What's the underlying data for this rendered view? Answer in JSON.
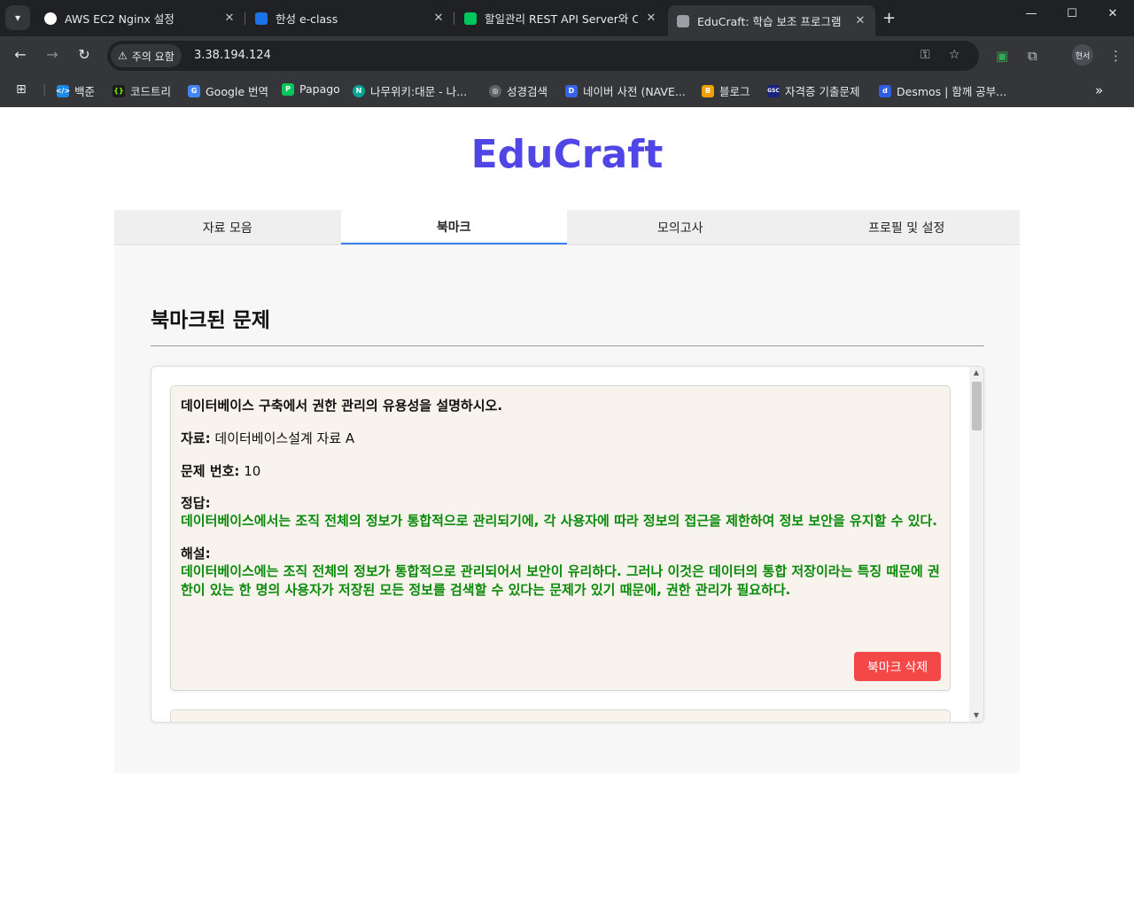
{
  "browser": {
    "tabs": [
      {
        "title": "AWS EC2 Nginx 설정",
        "active": false,
        "favicon": "openai-icon"
      },
      {
        "title": "한성 e-class",
        "active": false,
        "favicon": "eclass-icon"
      },
      {
        "title": "할일관리 REST API Server와 Cl",
        "active": false,
        "favicon": "blog-icon"
      },
      {
        "title": "EduCraft: 학습 보조 프로그램",
        "active": true,
        "favicon": "educraft-icon"
      }
    ],
    "security_chip": "주의 요함",
    "url": "3.38.194.124",
    "profile_label": "현서",
    "bookmarks": [
      {
        "label": "백준",
        "color": "#1e88e5",
        "glyph": "</>"
      },
      {
        "label": "코드트리",
        "color": "#1b1b1b",
        "glyph": "{}"
      },
      {
        "label": "Google 번역",
        "color": "#4285f4",
        "glyph": "G"
      },
      {
        "label": "Papago",
        "color": "#03c75a",
        "glyph": "P"
      },
      {
        "label": "나무위키:대문 - 나...",
        "color": "#00a495",
        "glyph": "N"
      },
      {
        "label": "성경검색",
        "color": "#5f6368",
        "glyph": "◎"
      },
      {
        "label": "네이버 사전 (NAVE...",
        "color": "#3563e9",
        "glyph": "D"
      },
      {
        "label": "블로그",
        "color": "#f6a000",
        "glyph": "B"
      },
      {
        "label": "자격증 기출문제",
        "color": "#1a237e",
        "glyph": "GSC"
      },
      {
        "label": "Desmos | 함께 공부...",
        "color": "#2f5fe0",
        "glyph": "d"
      }
    ]
  },
  "app": {
    "brand": "EduCraft",
    "brand_color": "#4f46e5",
    "nav_tabs": [
      {
        "label": "자료 모음",
        "active": false
      },
      {
        "label": "북마크",
        "active": true
      },
      {
        "label": "모의고사",
        "active": false
      },
      {
        "label": "프로필 및 설정",
        "active": false
      }
    ],
    "section_title": "북마크된 문제",
    "bookmarks": [
      {
        "question": "데이터베이스 구축에서 권한 관리의 유용성을 설명하시오.",
        "source_label": "자료:",
        "source_value": "데이터베이스설계 자료 A",
        "number_label": "문제 번호:",
        "number_value": "10",
        "answer_label": "정답:",
        "answer_text": "데이터베이스에서는 조직 전체의 정보가 통합적으로 관리되기에, 각 사용자에 따라 정보의 접근을 제한하여 정보 보안을 유지할 수 있다.",
        "explanation_label": "해설:",
        "explanation_text": "데이터베이스에는 조직 전체의 정보가 통합적으로 관리되어서 보안이 유리하다. 그러나 이것은 데이터의 통합 저장이라는 특징 때문에 권한이 있는 한 명의 사용자가 저장된 모든 정보를 검색할 수 있다는 문제가 있기 때문에, 권한 관리가 필요하다.",
        "delete_label": "북마크 삭제"
      }
    ],
    "delete_color": "#f44848",
    "answer_color": "#0a8a0a"
  }
}
